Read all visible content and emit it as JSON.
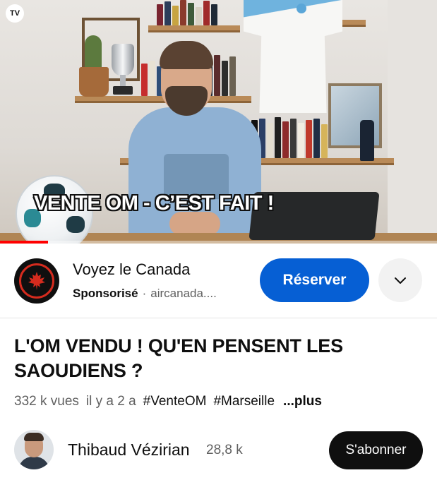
{
  "player": {
    "channel_watermark": "TV",
    "overlay_title": "VENTE OM - C’EST FAIT !",
    "progress_fraction": 0.11
  },
  "ad": {
    "advertiser": "Voyez le Canada",
    "sponsored_label": "Sponsorisé",
    "separator": "·",
    "domain": "aircanada....",
    "cta_label": "Réserver",
    "expand_icon": "chevron-down-icon",
    "logo_icon": "maple-leaf-icon"
  },
  "video": {
    "title": "L'OM VENDU ! QU'EN PENSENT LES SAOUDIENS ?",
    "views": "332 k vues",
    "age": "il y a 2 a",
    "hashtags": [
      "#VenteOM",
      "#Marseille"
    ],
    "more_label": "...plus"
  },
  "channel": {
    "name": "Thibaud Vézirian",
    "subscribers": "28,8 k",
    "subscribe_label": "S'abonner"
  },
  "colors": {
    "accent_blue": "#065fd4",
    "progress_red": "#ff0000",
    "air_canada_red": "#d52b1e"
  }
}
